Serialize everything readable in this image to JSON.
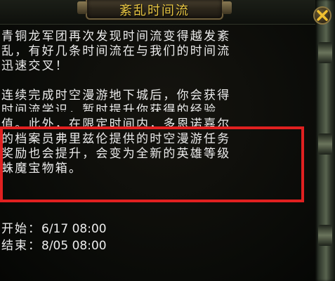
{
  "window": {
    "title": "紊乱时间流",
    "close_label": "×"
  },
  "body": {
    "paragraph1": [
      "青铜龙军团再次发现时间流变得越发紊",
      "乱，有好几条时间流在与我们的时间流",
      "迅速交叉！"
    ],
    "paragraph2": [
      "连续完成时空漫游地下城后，你会获得",
      "时间流学识，暂时提升你获得的经验",
      "值。此外，在限定时间内，多恩诺嘉尔",
      "的档案员弗里兹伦提供的时空漫游任务",
      "奖励也会提升，会变为全新的英雄等级",
      "蛛魔宝物箱。"
    ]
  },
  "schedule": {
    "start_label": "开始：",
    "start_value": "6/17 08:00",
    "end_label": "结束：",
    "end_value": "8/05 08:00"
  },
  "colors": {
    "title": "#e6c443",
    "text": "#ececec",
    "highlight": "#e02020"
  }
}
